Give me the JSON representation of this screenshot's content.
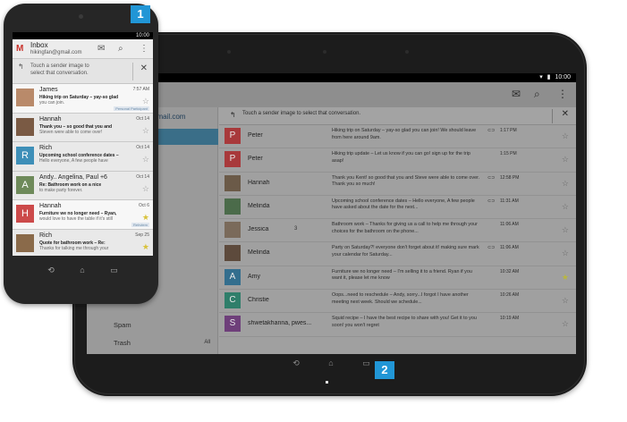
{
  "callouts": [
    "1",
    "2"
  ],
  "tablet": {
    "status": {
      "time": "10:00",
      "icons": [
        "wifi-icon",
        "battery-icon"
      ]
    },
    "action_icons": [
      "compose-icon",
      "search-icon",
      "overflow-menu-icon"
    ],
    "account_email": "hikingfan@gmail.com",
    "account_email_visible": "gmail.com",
    "hint": "Touch a sender image to select that conversation.",
    "close_glyph": "✕",
    "nav": [
      {
        "label": "Spam",
        "count": ""
      },
      {
        "label": "Trash",
        "count": "All"
      }
    ],
    "conversations": [
      {
        "avatar": "P",
        "color": "#a8393b",
        "sender": "Peter",
        "count": "",
        "snippet": "Hiking trip on Saturday – yay-so glad you can join! We should leave from here around 9am.",
        "clip": true,
        "time": "1:17 PM",
        "starred": false
      },
      {
        "avatar": "P",
        "color": "#a8393b",
        "sender": "Peter",
        "count": "",
        "snippet": "Hiking trip update – Let us know if you can go! sign up for the trip asap!",
        "clip": false,
        "time": "1:15 PM",
        "starred": false
      },
      {
        "avatar": "",
        "color": "#6b5a48",
        "sender": "Hannah",
        "count": "",
        "snippet": "Thank you Kent! so good that you and Steve were able to come over. Thank you so much!",
        "clip": true,
        "time": "12:58 PM",
        "starred": false
      },
      {
        "avatar": "",
        "color": "#4b6b4a",
        "sender": "Melinda",
        "count": "",
        "snippet": "Upcoming school conference dates – Hello everyone, A few people have asked about the date for the next...",
        "clip": true,
        "time": "11:31 AM",
        "starred": false
      },
      {
        "avatar": "",
        "color": "#7a6a5a",
        "sender": "Jessica",
        "count": "3",
        "snippet": "Bathroom work – Thanks for giving us a call to help me through your choices for the bathroom on the phone...",
        "clip": false,
        "time": "11:06 AM",
        "starred": false
      },
      {
        "avatar": "",
        "color": "#5d4a3c",
        "sender": "Melinda",
        "count": "",
        "snippet": "Party on Saturday?! everyone don't forget about it! making sure mark your calendar for Saturday...",
        "clip": true,
        "time": "11:06 AM",
        "starred": false
      },
      {
        "avatar": "A",
        "color": "#336e8e",
        "sender": "Amy",
        "count": "",
        "snippet": "Furniture we no longer need – I'm selling it to a friend. Ryan if you want it, please let me know",
        "clip": false,
        "time": "10:32 AM",
        "starred": true
      },
      {
        "avatar": "C",
        "color": "#2f7e6a",
        "sender": "Christie",
        "count": "",
        "snippet": "Oops...need to reschedule – Andy, sorry...I forgot I have another meeting next week. Should we schedule...",
        "clip": false,
        "time": "10:26 AM",
        "starred": false
      },
      {
        "avatar": "S",
        "color": "#6e3f7a",
        "sender": "shwetakhanna, pwes...",
        "count": "",
        "snippet": "Squid recipe – I have the best recipe to share with you! Get it to you soon! you won't regret",
        "clip": false,
        "time": "10:19 AM",
        "starred": false
      }
    ],
    "navbar": [
      "back-icon",
      "home-icon",
      "recents-icon"
    ]
  },
  "phone": {
    "status": {
      "time": "10:00"
    },
    "title": "Inbox",
    "account_email": "hikingfan@gmail.com",
    "hint_line1": "Touch a sender image to",
    "hint_line2": "select that conversation.",
    "close_glyph": "✕",
    "conversations": [
      {
        "avatar": "",
        "color": "#b98a6a",
        "sender": "James",
        "subject": "Hiking trip on Saturday – yay-so glad",
        "snippet": "you can join.",
        "time": "7:57 AM",
        "starred": false,
        "label": "Personal Participant",
        "unread": true
      },
      {
        "avatar": "",
        "color": "#7a5a44",
        "sender": "Hannah",
        "subject": "Thank you – so good that you and",
        "snippet": "Steven were able to come over!",
        "time": "Oct 14",
        "starred": false,
        "label": "",
        "unread": false
      },
      {
        "avatar": "R",
        "color": "#3e8fb8",
        "sender": "Rich",
        "subject": "Upcoming school conference dates –",
        "snippet": "Hello everyone, A few people have",
        "time": "Oct 14",
        "starred": false,
        "label": "",
        "unread": false
      },
      {
        "avatar": "A",
        "color": "#6e8a5a",
        "sender": "Andy.. Angelina, Paul +6",
        "subject": "Re: Bathroom work on a nice",
        "snippet": "to make party forever.",
        "time": "Oct 14",
        "starred": false,
        "label": "",
        "unread": false
      },
      {
        "avatar": "H",
        "color": "#cc4a4a",
        "sender": "Hannah",
        "subject": "Furniture we no longer need – Ryan,",
        "snippet": "would love to have the table if it's still",
        "time": "Oct 6",
        "starred": true,
        "label": "Rehvtem",
        "unread": true
      },
      {
        "avatar": "",
        "color": "#8a6a4a",
        "sender": "Rich",
        "subject": "Quote for bathroom work – Re:",
        "snippet": "Thanks for talking me through your",
        "time": "Sep 25",
        "starred": true,
        "label": "",
        "unread": false
      }
    ],
    "navbar": [
      "back-icon",
      "home-icon",
      "recents-icon"
    ]
  }
}
